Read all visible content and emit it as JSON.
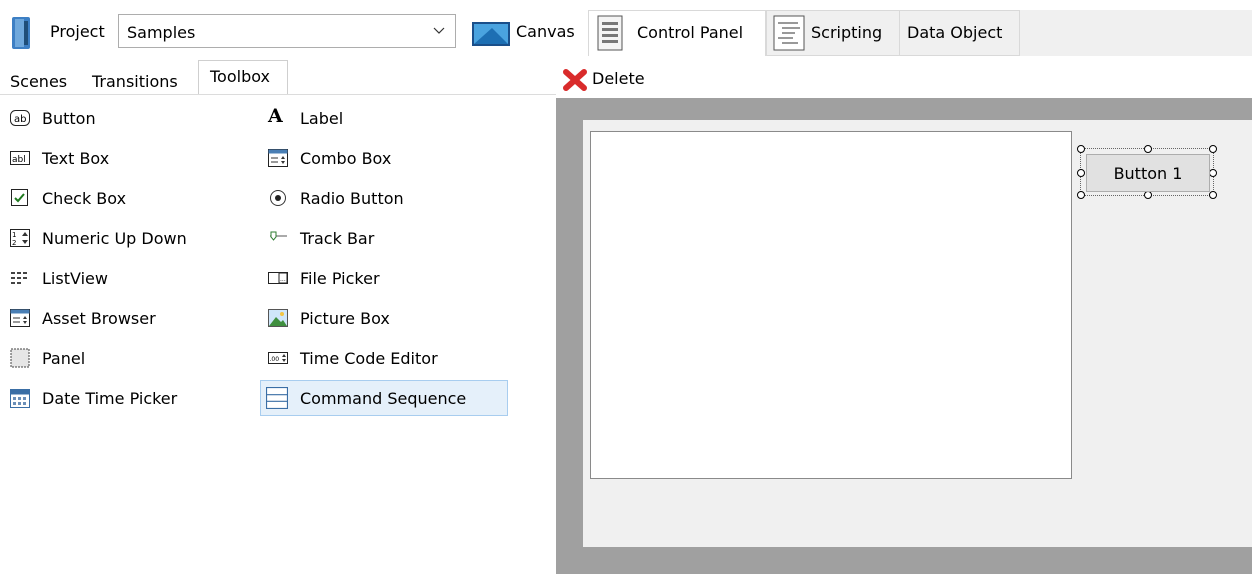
{
  "header": {
    "project_label": "Project",
    "project_value": "Samples"
  },
  "tabs": [
    {
      "label": "Canvas"
    },
    {
      "label": "Control Panel",
      "selected": true
    },
    {
      "label": "Scripting"
    },
    {
      "label": "Data Object"
    }
  ],
  "subtabs": [
    {
      "label": "Scenes"
    },
    {
      "label": "Transitions"
    },
    {
      "label": "Toolbox",
      "selected": true
    }
  ],
  "toolbox": {
    "left_column": [
      {
        "label": "Button",
        "icon": "button-icon"
      },
      {
        "label": "Text Box",
        "icon": "textbox-icon"
      },
      {
        "label": "Check Box",
        "icon": "checkbox-icon"
      },
      {
        "label": "Numeric Up Down",
        "icon": "numeric-up-down-icon"
      },
      {
        "label": "ListView",
        "icon": "listview-icon"
      },
      {
        "label": "Asset Browser",
        "icon": "asset-browser-icon"
      },
      {
        "label": "Panel",
        "icon": "panel-icon"
      },
      {
        "label": "Date Time Picker",
        "icon": "calendar-icon"
      }
    ],
    "right_column": [
      {
        "label": "Label",
        "icon": "label-icon"
      },
      {
        "label": "Combo Box",
        "icon": "combobox-icon"
      },
      {
        "label": "Radio Button",
        "icon": "radio-button-icon"
      },
      {
        "label": "Track Bar",
        "icon": "trackbar-icon"
      },
      {
        "label": "File Picker",
        "icon": "file-picker-icon"
      },
      {
        "label": "Picture Box",
        "icon": "picture-icon"
      },
      {
        "label": "Time Code Editor",
        "icon": "timecode-icon"
      },
      {
        "label": "Command Sequence",
        "icon": "command-sequence-icon",
        "selected": true
      }
    ]
  },
  "toolbar": {
    "delete_label": "Delete"
  },
  "designer": {
    "button_text": "Button 1"
  },
  "colors": {
    "designer_background": "#a0a0a0",
    "surface": "#f0f0f0",
    "selection_highlight": "#e5f0fa",
    "delete_red": "#d92b2b"
  }
}
